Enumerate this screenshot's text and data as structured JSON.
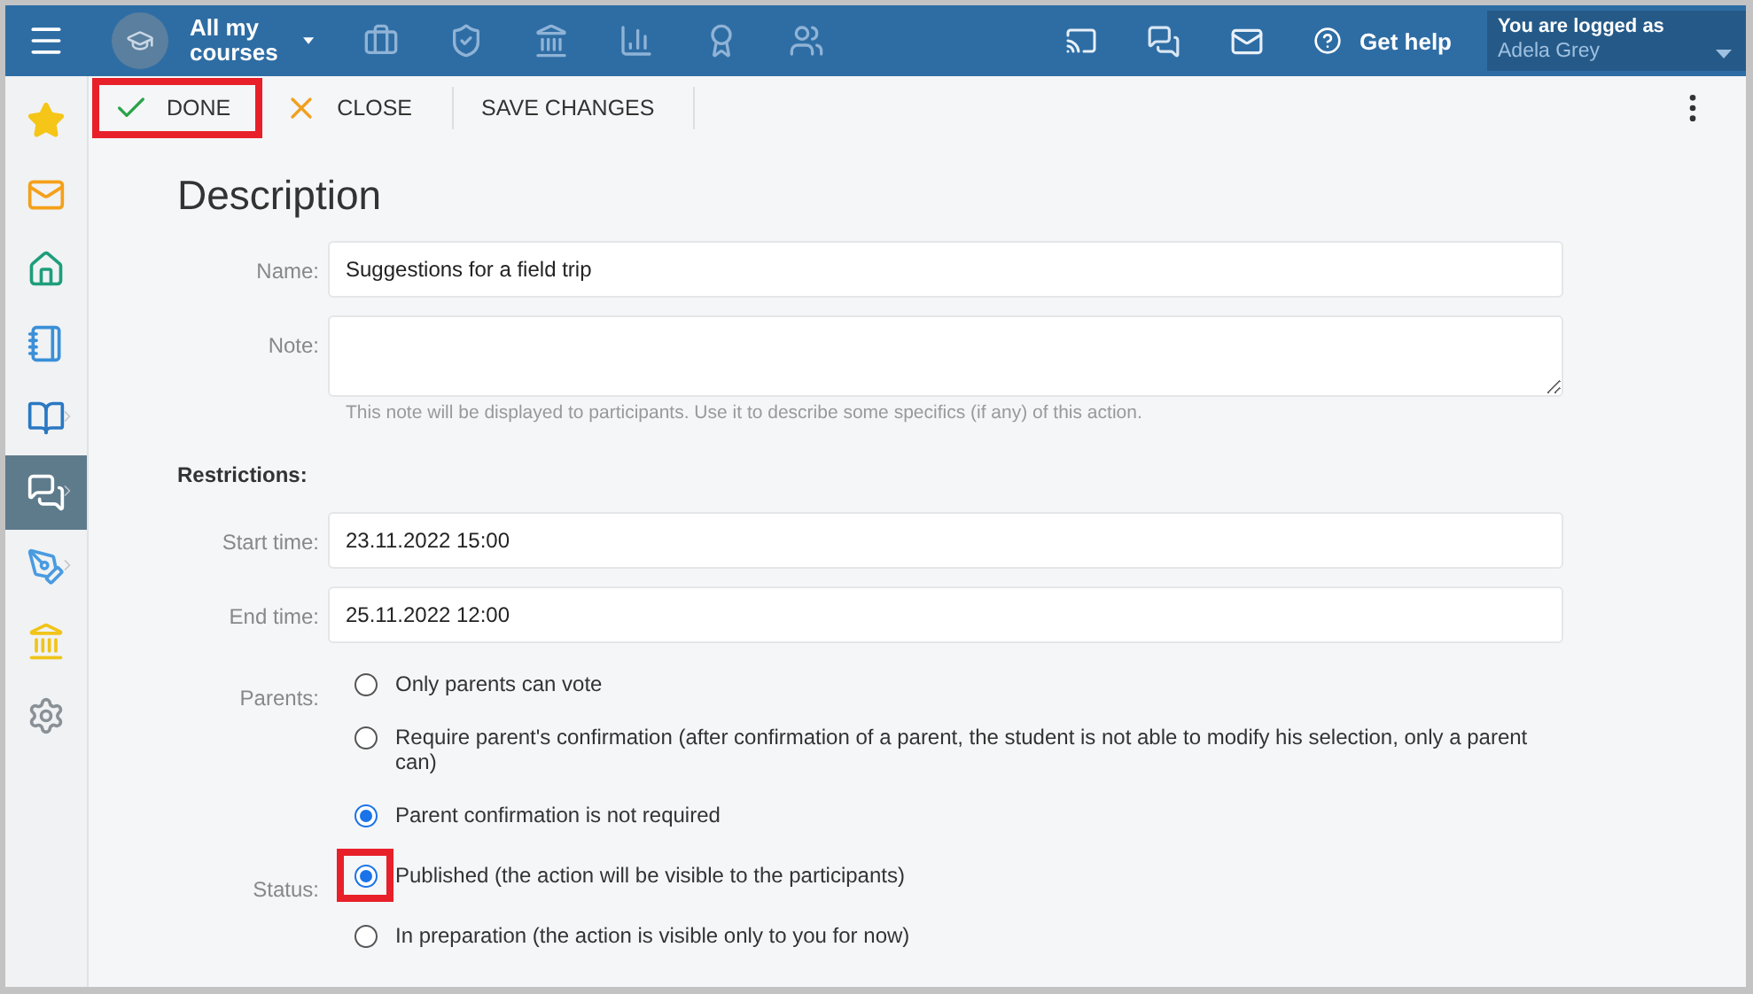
{
  "top_bar": {
    "course_menu": "All my courses",
    "help": "Get help",
    "user": {
      "caption": "You are logged as",
      "name": "Adela Grey"
    }
  },
  "sidebar": {
    "items": [
      {
        "kind": "star",
        "color": "#f5c518",
        "selected": false,
        "has_submenu": false
      },
      {
        "kind": "mail",
        "color": "#f5a01a",
        "selected": false,
        "has_submenu": false
      },
      {
        "kind": "home",
        "color": "#1e9e7a",
        "selected": false,
        "has_submenu": false
      },
      {
        "kind": "notebook",
        "color": "#3a8fd8",
        "selected": false,
        "has_submenu": false
      },
      {
        "kind": "book",
        "color": "#2a78c2",
        "selected": false,
        "has_submenu": true
      },
      {
        "kind": "chat",
        "color": "#ffffff",
        "selected": true,
        "has_submenu": true
      },
      {
        "kind": "pen",
        "color": "#4a9be0",
        "selected": false,
        "has_submenu": true
      },
      {
        "kind": "bank",
        "color": "#f0c419",
        "selected": false,
        "has_submenu": false
      },
      {
        "kind": "gear",
        "color": "#8a9196",
        "selected": false,
        "has_submenu": false
      }
    ]
  },
  "toolbar": {
    "buttons": [
      {
        "kind": "done",
        "label": "DONE",
        "highlighted": true
      },
      {
        "kind": "close",
        "label": "CLOSE",
        "highlighted": false
      },
      {
        "kind": "save",
        "label": "SAVE CHANGES",
        "highlighted": false
      }
    ]
  },
  "form": {
    "title": "Description",
    "name": {
      "label": "Name:",
      "value": "Suggestions for a field trip"
    },
    "note": {
      "label": "Note:",
      "hint": "This note will be displayed to participants. Use it to describe some specifics (if any) of this action."
    },
    "restrictions": "Restrictions:",
    "start_time": {
      "label": "Start time:",
      "value": "23.11.2022 15:00"
    },
    "end_time": {
      "label": "End time:",
      "value": "25.11.2022 12:00"
    },
    "parents": {
      "label": "Parents:",
      "options": [
        {
          "label": "Only parents can vote",
          "selected": false,
          "highlighted": false
        },
        {
          "label": "Require parent's confirmation (after confirmation of a parent, the student is not able to modify his selection, only a parent can)",
          "selected": false,
          "highlighted": false
        },
        {
          "label": "Parent confirmation is not required",
          "selected": true,
          "highlighted": false
        }
      ]
    },
    "status": {
      "label": "Status:",
      "options": [
        {
          "label": "Published (the action will be visible to the participants)",
          "selected": true,
          "highlighted": true
        },
        {
          "label": "In preparation (the action is visible only to you for now)",
          "selected": false,
          "highlighted": false
        }
      ]
    }
  }
}
